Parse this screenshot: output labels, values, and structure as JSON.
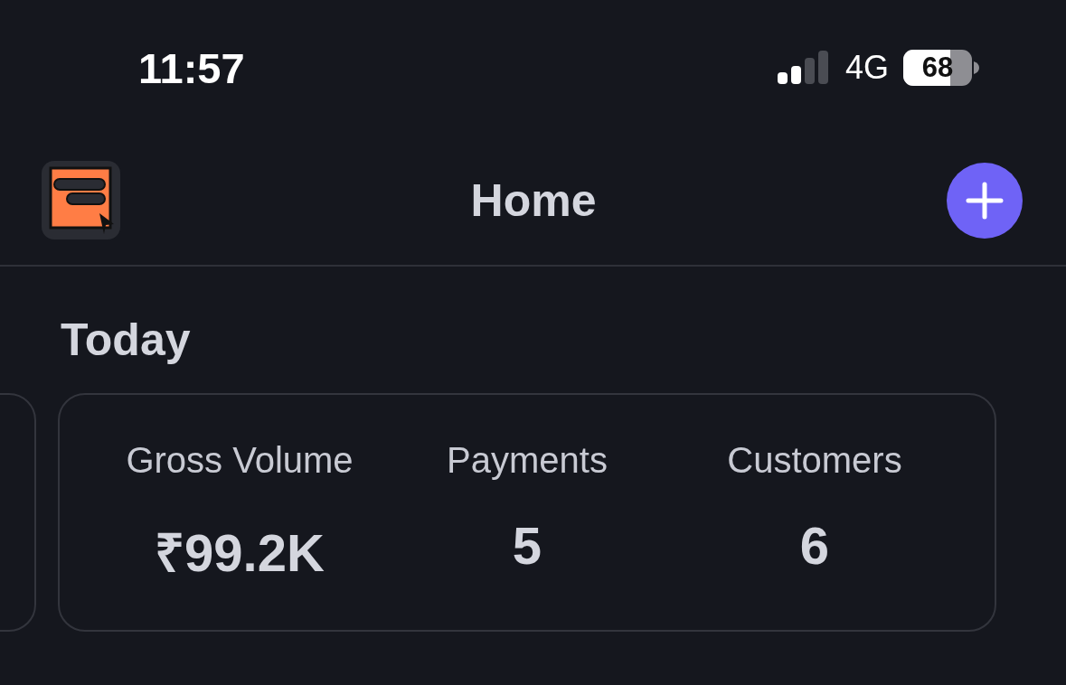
{
  "status_bar": {
    "time": "11:57",
    "network": "4G",
    "battery": "68"
  },
  "nav": {
    "title": "Home"
  },
  "section": {
    "title": "Today"
  },
  "stats": [
    {
      "label": "Gross Volume",
      "value": "₹99.2K"
    },
    {
      "label": "Payments",
      "value": "5"
    },
    {
      "label": "Customers",
      "value": "6"
    }
  ]
}
